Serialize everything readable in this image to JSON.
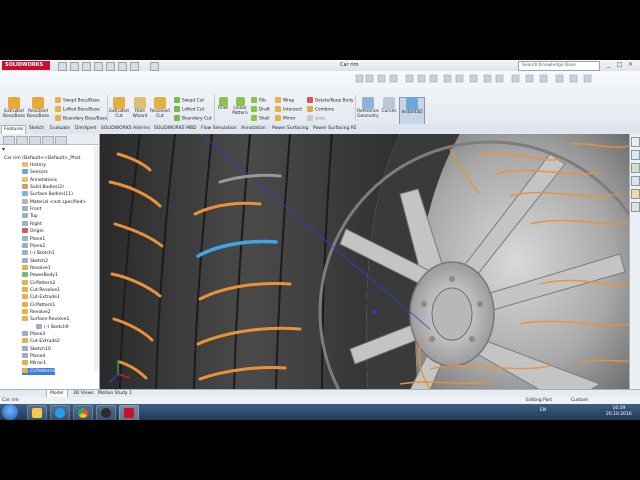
{
  "app": {
    "name": "SOLIDWORKS",
    "doc_title": "Car rim",
    "search_placeholder": "Search Knowledge Base"
  },
  "ribbon": {
    "big_buttons": [
      {
        "id": "extruded-boss",
        "label": "Extruded Boss/Base",
        "color": "#e8a83a"
      },
      {
        "id": "revolved-boss",
        "label": "Revolved Boss/Base",
        "color": "#e8a83a"
      },
      {
        "id": "extruded-cut",
        "label": "Extruded Cut",
        "color": "#e0b040"
      },
      {
        "id": "hole-wizard",
        "label": "Hole Wizard",
        "color": "#d9c07a"
      },
      {
        "id": "revolved-cut",
        "label": "Revolved Cut",
        "color": "#e0b040"
      },
      {
        "id": "reference-geometry",
        "label": "Reference Geometry",
        "color": "#8fb3d8"
      },
      {
        "id": "curves",
        "label": "Curves",
        "color": "#b9c6d4"
      },
      {
        "id": "instant3d",
        "label": "Instant3D",
        "color": "#6fa8d6"
      }
    ],
    "small_buttons": [
      {
        "id": "swept-boss",
        "label": "Swept Boss/Base"
      },
      {
        "id": "lofted-boss",
        "label": "Lofted Boss/Base"
      },
      {
        "id": "boundary-boss",
        "label": "Boundary Boss/Base"
      },
      {
        "id": "swept-cut",
        "label": "Swept Cut"
      },
      {
        "id": "lofted-cut",
        "label": "Lofted Cut"
      },
      {
        "id": "boundary-cut",
        "label": "Boundary Cut"
      },
      {
        "id": "fillet",
        "label": "Fillet"
      },
      {
        "id": "linear-pattern",
        "label": "Linear Pattern"
      },
      {
        "id": "rib",
        "label": "Rib"
      },
      {
        "id": "draft",
        "label": "Draft"
      },
      {
        "id": "shell",
        "label": "Shell"
      },
      {
        "id": "wrap",
        "label": "Wrap"
      },
      {
        "id": "intersect",
        "label": "Intersect"
      },
      {
        "id": "mirror",
        "label": "Mirror"
      },
      {
        "id": "delete-keep-body",
        "label": "Delete/Keep Body"
      },
      {
        "id": "combine",
        "label": "Combine"
      },
      {
        "id": "slots",
        "label": "slots"
      }
    ]
  },
  "tabs": [
    "Features",
    "Sketch",
    "Evaluate",
    "DimXpert",
    "SOLIDWORKS Add-Ins",
    "SOLIDWORKS MBD",
    "Flow Simulation",
    "Annotation",
    "Power Surfacing",
    "Power Surfacing RE"
  ],
  "tree": {
    "root": "Car rim  (Default<<Default>_Phot",
    "items": [
      "History",
      "Sensors",
      "Annotations",
      "Solid Bodies(2)",
      "Surface Bodies(11)",
      "Material <not specified>",
      "Front",
      "Top",
      "Right",
      "Origin",
      "Plane1",
      "Plane2",
      "(-) Sketch1",
      "Sketch2",
      "Revolve1",
      "PowerBody1",
      "CirPattern2",
      "Cut-Revolve1",
      "Cut-Extrude1",
      "CirPattern1",
      "Revolve2",
      "Surface-Revolve1",
      "(-) Sketch9",
      "Plane3",
      "Cut-Extrude2",
      "Sketch10",
      "Plane4",
      "Mirror1",
      "CirPattern4"
    ],
    "selected_index": 28
  },
  "bottom_tabs": [
    "Model",
    "3D Views",
    "Motion Study 1"
  ],
  "part_name": "Car rim",
  "status": {
    "mode": "Editing Part",
    "units": "Custom"
  },
  "taskbar": {
    "lang": "EN",
    "time": "16:39",
    "date": "20.10.2016"
  }
}
